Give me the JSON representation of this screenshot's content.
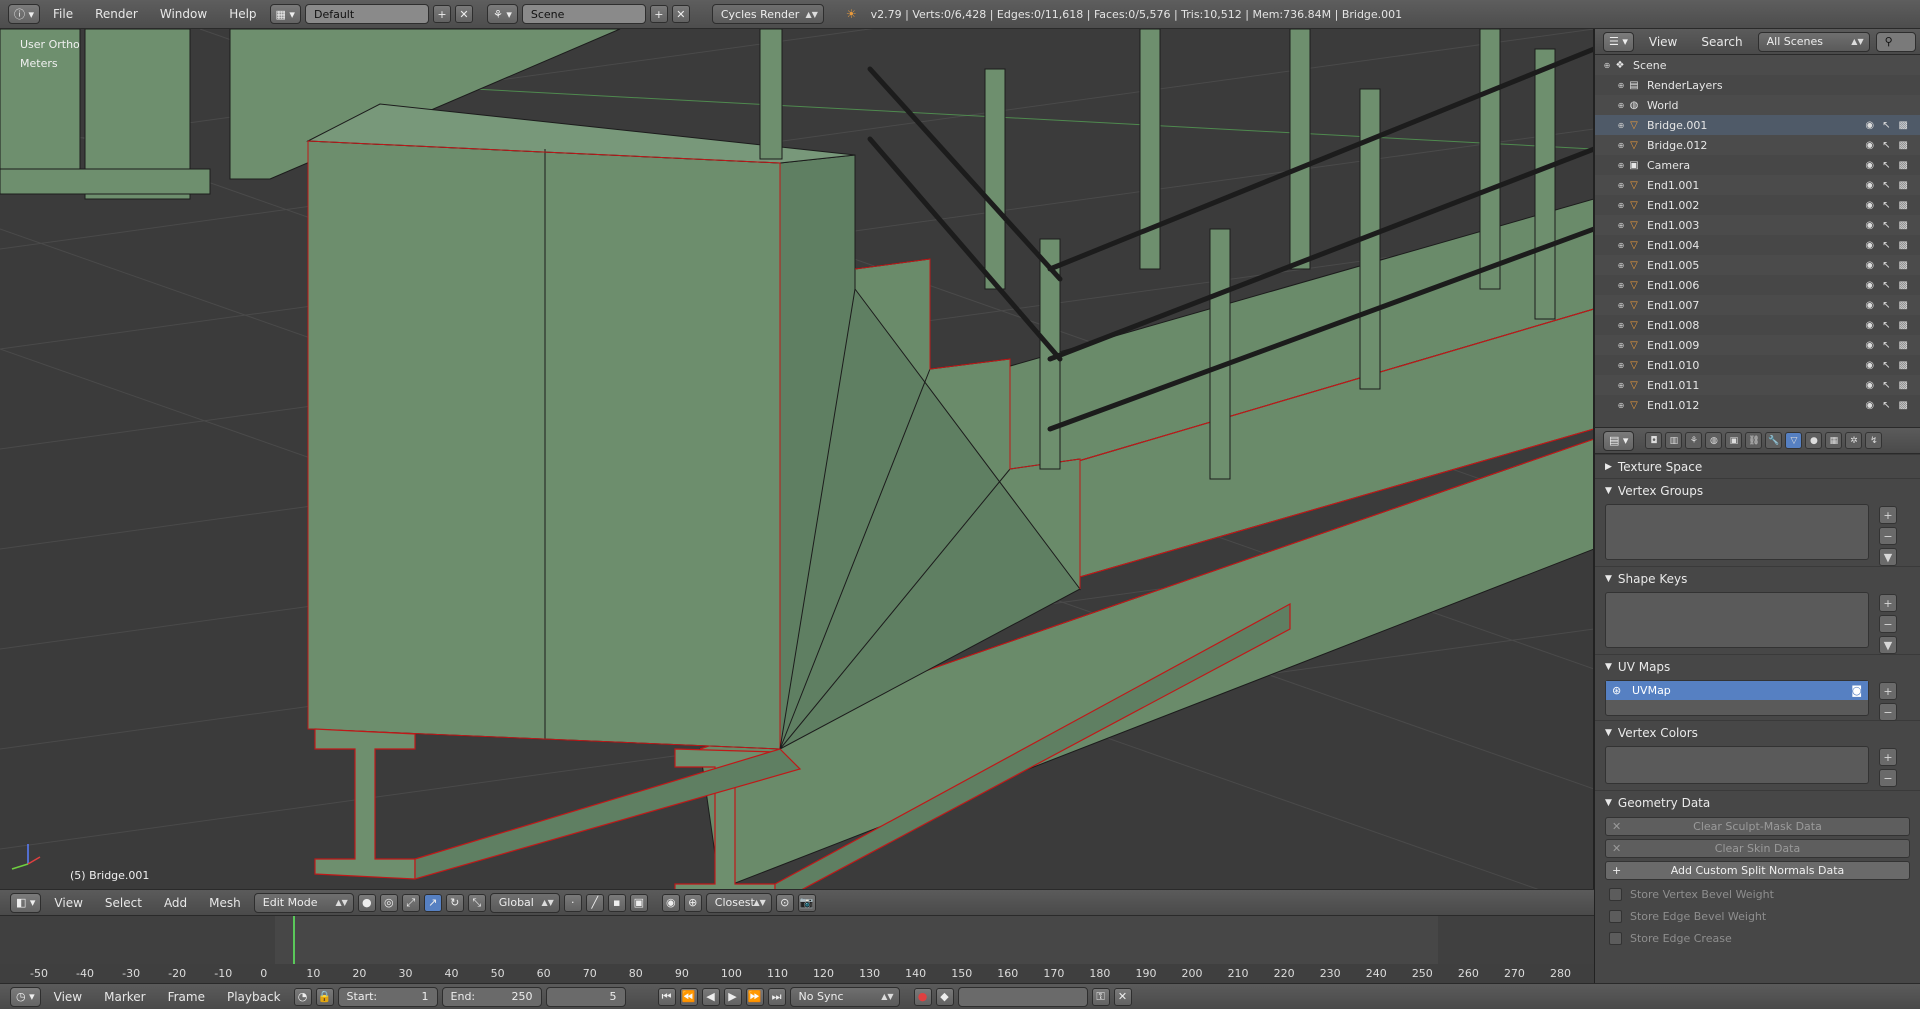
{
  "top_bar": {
    "menus": [
      "File",
      "Render",
      "Window",
      "Help"
    ],
    "layout": "Default",
    "scene": "Scene",
    "engine": "Cycles Render",
    "stats": "v2.79 | Verts:0/6,428 | Edges:0/11,618 | Faces:0/5,576 | Tris:10,512 | Mem:736.84M | Bridge.001"
  },
  "viewport": {
    "view_name": "User Ortho",
    "units": "Meters",
    "object_label": "(5) Bridge.001"
  },
  "vp_header": {
    "menus": [
      "View",
      "Select",
      "Add",
      "Mesh"
    ],
    "mode": "Edit Mode",
    "orientation": "Global",
    "snap": "Closest"
  },
  "timeline": {
    "ticks": [
      "-50",
      "-40",
      "-30",
      "-20",
      "-10",
      "0",
      "10",
      "20",
      "30",
      "40",
      "50",
      "60",
      "70",
      "80",
      "90",
      "100",
      "110",
      "120",
      "130",
      "140",
      "150",
      "160",
      "170",
      "180",
      "190",
      "200",
      "210",
      "220",
      "230",
      "240",
      "250",
      "260",
      "270",
      "280"
    ],
    "current_frame": 5
  },
  "timeline_header": {
    "menus": [
      "View",
      "Marker",
      "Frame",
      "Playback"
    ],
    "start_label": "Start:",
    "start_value": "1",
    "end_label": "End:",
    "end_value": "250",
    "frame_value": "5",
    "sync": "No Sync"
  },
  "outliner": {
    "menus": [
      "View",
      "Search"
    ],
    "filter": "All Scenes",
    "items": [
      {
        "name": "Scene",
        "level": 0,
        "type": "scene"
      },
      {
        "name": "RenderLayers",
        "level": 1,
        "type": "render"
      },
      {
        "name": "World",
        "level": 1,
        "type": "world"
      },
      {
        "name": "Bridge.001",
        "level": 1,
        "type": "mesh"
      },
      {
        "name": "Bridge.012",
        "level": 1,
        "type": "mesh"
      },
      {
        "name": "Camera",
        "level": 1,
        "type": "camera"
      },
      {
        "name": "End1.001",
        "level": 1,
        "type": "mesh"
      },
      {
        "name": "End1.002",
        "level": 1,
        "type": "mesh"
      },
      {
        "name": "End1.003",
        "level": 1,
        "type": "mesh"
      },
      {
        "name": "End1.004",
        "level": 1,
        "type": "mesh"
      },
      {
        "name": "End1.005",
        "level": 1,
        "type": "mesh"
      },
      {
        "name": "End1.006",
        "level": 1,
        "type": "mesh"
      },
      {
        "name": "End1.007",
        "level": 1,
        "type": "mesh"
      },
      {
        "name": "End1.008",
        "level": 1,
        "type": "mesh"
      },
      {
        "name": "End1.009",
        "level": 1,
        "type": "mesh"
      },
      {
        "name": "End1.010",
        "level": 1,
        "type": "mesh"
      },
      {
        "name": "End1.011",
        "level": 1,
        "type": "mesh"
      },
      {
        "name": "End1.012",
        "level": 1,
        "type": "mesh"
      }
    ]
  },
  "properties": {
    "panels": {
      "texture_space": "Texture Space",
      "vertex_groups": "Vertex Groups",
      "shape_keys": "Shape Keys",
      "uv_maps": "UV Maps",
      "vertex_colors": "Vertex Colors",
      "geometry_data": "Geometry Data"
    },
    "uv_map_name": "UVMap",
    "buttons": {
      "clear_sculpt": "Clear Sculpt-Mask Data",
      "clear_skin": "Clear Skin Data",
      "add_split_normals": "Add Custom Split Normals Data"
    },
    "checks": {
      "bevel_vertex": "Store Vertex Bevel Weight",
      "bevel_edge": "Store Edge Bevel Weight",
      "edge_crease": "Store Edge Crease"
    }
  },
  "colors": {
    "mesh_fill": "#6e8f6e",
    "edge_select": "#c01818",
    "accent_blue": "#5680c2"
  }
}
